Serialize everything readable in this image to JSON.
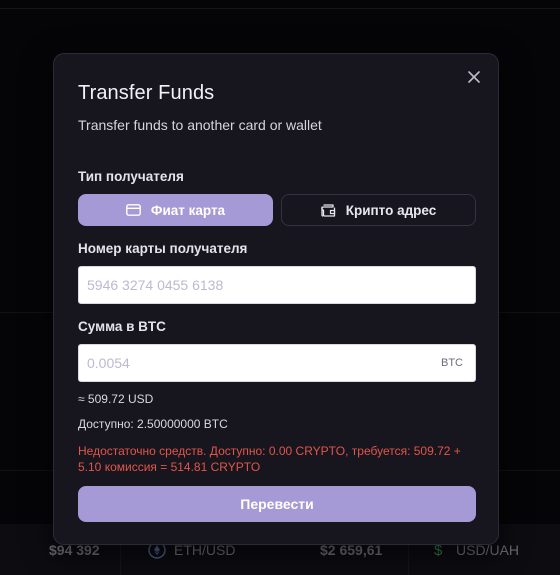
{
  "ticker": {
    "price_1": "$94 392",
    "pair_1": "ETH/USD",
    "price_2": "$2 659,61",
    "pair_2": "USD/UAH",
    "eth_icon": "ethereum-icon",
    "dollar_icon": "dollar-icon"
  },
  "modal": {
    "title": "Transfer Funds",
    "subtitle": "Transfer funds to another card or wallet",
    "close_icon": "close-icon",
    "recipient_type_label": "Тип получателя",
    "tabs": [
      {
        "label": "Фиат карта",
        "icon": "credit-card-icon",
        "active": true
      },
      {
        "label": "Крипто адрес",
        "icon": "wallet-icon",
        "active": false
      }
    ],
    "card_number_label": "Номер карты получателя",
    "card_number_placeholder": "5946 3274 0455 6138",
    "card_number_value": "",
    "amount_label": "Сумма в BTC",
    "amount_placeholder": "0.0054",
    "amount_value": "",
    "amount_suffix": "BTC",
    "usd_equivalent": "≈ 509.72 USD",
    "available": "Доступно: 2.50000000 BTC",
    "error": "Недостаточно средств. Доступно: 0.00 CRYPTO, требуется: 509.72 + 5.10 комиссия = 514.81 CRYPTO",
    "submit_label": "Перевести"
  },
  "colors": {
    "accent": "#a59ad6",
    "modal_bg": "#17161f",
    "error": "#e2554a",
    "page_bg": "#050507"
  }
}
